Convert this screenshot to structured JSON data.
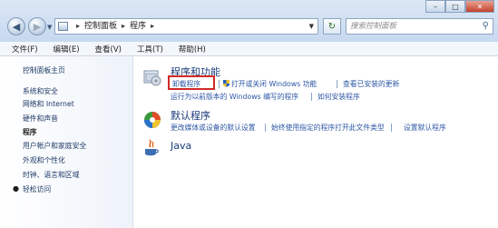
{
  "address": {
    "crumbs": [
      "控制面板",
      "程序"
    ]
  },
  "search": {
    "placeholder": "搜索控制面板"
  },
  "menu": [
    "文件(F)",
    "编辑(E)",
    "查看(V)",
    "工具(T)",
    "帮助(H)"
  ],
  "sidebar": {
    "items": [
      {
        "label": "控制面板主页"
      },
      {
        "label": "系统和安全"
      },
      {
        "label": "网络和 Internet"
      },
      {
        "label": "硬件和声音"
      },
      {
        "label": "程序",
        "current": true
      },
      {
        "label": "用户帐户和家庭安全"
      },
      {
        "label": "外观和个性化"
      },
      {
        "label": "时钟、语言和区域"
      },
      {
        "label": "轻松访问"
      }
    ]
  },
  "categories": {
    "programs": {
      "title": "程序和功能",
      "links": [
        "卸载程序",
        "打开或关闭 Windows 功能",
        "查看已安装的更新",
        "运行为以前版本的 Windows 编写的程序",
        "如何安装程序"
      ]
    },
    "defaults": {
      "title": "默认程序",
      "links": [
        "更改媒体或设备的默认设置",
        "始终使用指定的程序打开此文件类型",
        "设置默认程序"
      ]
    },
    "java": {
      "title": "Java"
    }
  },
  "icons": {
    "back": "arrow-left",
    "forward": "arrow-right",
    "refresh": "refresh",
    "search": "magnifier",
    "shield": "uac-shield"
  },
  "colors": {
    "link": "#2b56a4",
    "category_title": "#1b3b7a",
    "highlight_box": "#d02a28"
  }
}
